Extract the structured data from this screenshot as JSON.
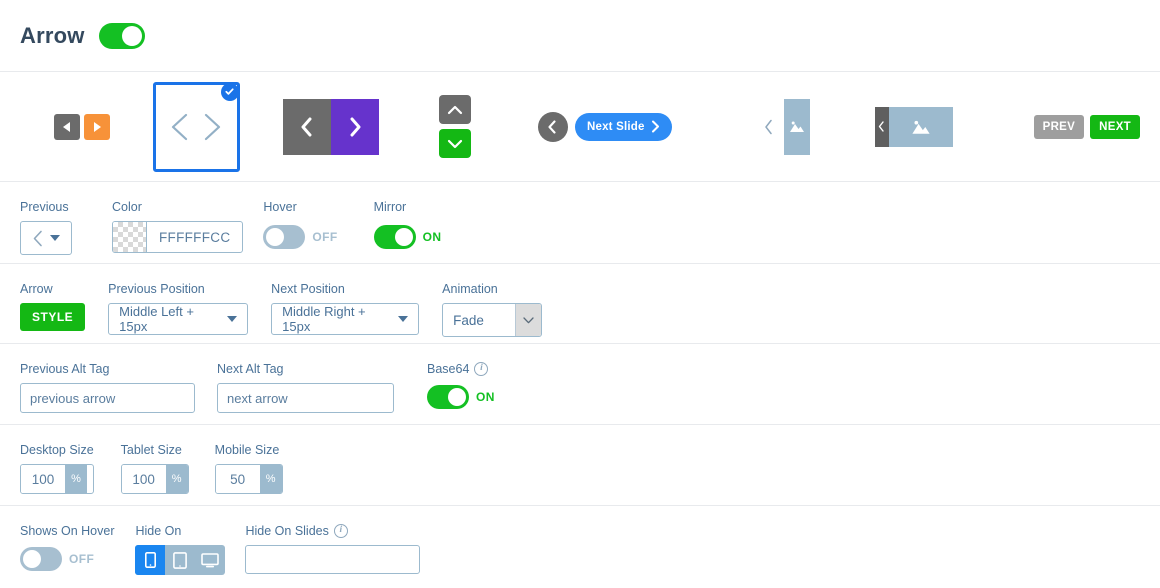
{
  "header": {
    "title": "Arrow",
    "toggle_state": "on"
  },
  "previews": {
    "items": [
      {
        "name": "preview-arrow-small-squares",
        "selected": false
      },
      {
        "name": "preview-arrow-chevron-card",
        "selected": true
      },
      {
        "name": "preview-arrow-large-squares",
        "selected": false
      },
      {
        "name": "preview-arrow-vertical-chevrons",
        "selected": false
      },
      {
        "name": "preview-arrow-next-slide-pill",
        "selected": false,
        "pill_label": "Next Slide"
      },
      {
        "name": "preview-arrow-thumbnail-tall",
        "selected": false
      },
      {
        "name": "preview-arrow-thumbnail-wide",
        "selected": false
      },
      {
        "name": "preview-arrow-prev-next-labels",
        "selected": false,
        "prev_label": "PREV",
        "next_label": "NEXT"
      }
    ]
  },
  "row_style": {
    "previous": {
      "label": "Previous"
    },
    "color": {
      "label": "Color",
      "value": "FFFFFFCC"
    },
    "hover": {
      "label": "Hover",
      "state": "OFF"
    },
    "mirror": {
      "label": "Mirror",
      "state": "ON"
    }
  },
  "row_position": {
    "arrow": {
      "label": "Arrow",
      "button": "STYLE"
    },
    "previous_position": {
      "label": "Previous Position",
      "value": "Middle Left + 15px"
    },
    "next_position": {
      "label": "Next Position",
      "value": "Middle Right + 15px"
    },
    "animation": {
      "label": "Animation",
      "value": "Fade"
    }
  },
  "row_alt": {
    "previous_alt": {
      "label": "Previous Alt Tag",
      "value": "previous arrow"
    },
    "next_alt": {
      "label": "Next Alt Tag",
      "value": "next arrow"
    },
    "base64": {
      "label": "Base64",
      "state": "ON",
      "info": "i"
    }
  },
  "row_size": {
    "desktop": {
      "label": "Desktop Size",
      "value": "100",
      "unit": "%"
    },
    "tablet": {
      "label": "Tablet Size",
      "value": "100",
      "unit": "%"
    },
    "mobile": {
      "label": "Mobile Size",
      "value": "50",
      "unit": "%"
    }
  },
  "row_visibility": {
    "shows_on_hover": {
      "label": "Shows On Hover",
      "state": "OFF"
    },
    "hide_on": {
      "label": "Hide On",
      "devices": [
        "mobile",
        "tablet",
        "desktop"
      ],
      "active": "mobile"
    },
    "hide_on_slides": {
      "label": "Hide On Slides",
      "value": "",
      "placeholder": "",
      "info": "i"
    }
  },
  "colors": {
    "green": "#14b814",
    "toggle_green": "#14c023",
    "blue": "#1a73e8",
    "pill_blue": "#2e8cf5",
    "device_blue": "#1a86f0",
    "grey": "#6b6b6b",
    "orange": "#f79239",
    "purple": "#6633cc",
    "steel": "#9cbace",
    "label_text": "#4a7298",
    "title_text": "#34495e"
  }
}
